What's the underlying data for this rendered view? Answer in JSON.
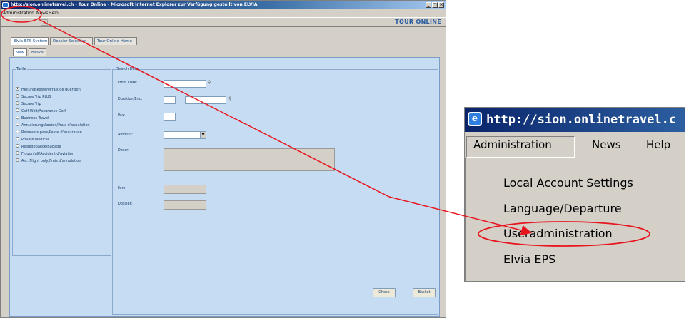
{
  "window": {
    "title": "http://sion.onlinetravel.ch - Tour Online - Microsoft Internet Explorer zur Verfügung gestellt von ELVIA",
    "controls": [
      "_",
      "□",
      "×"
    ]
  },
  "menubar": {
    "items": [
      "Administration",
      "News",
      "Help"
    ]
  },
  "toolbar": {
    "button_label": "»",
    "brand": "TOUR ONLINE"
  },
  "tabs": {
    "top": [
      "Elvia EPS System",
      "Dossier Selection",
      "Tour Online Home"
    ],
    "sub": [
      "New",
      "Basket"
    ]
  },
  "tarife": {
    "legend": "Tarife",
    "options": [
      "Heilungskosten/Frais de guerison",
      "Secure Trip PLUS",
      "Secure Trip",
      "Golf Welt/Assurance Golf",
      "Business Travel",
      "Annulierungskosten/Frais d'annulation",
      "Reisevers.pass/Passe d'assurance",
      "Private Medical",
      "Reisegepaeck/Bagage",
      "Flugunfall/Accident d'aviation",
      "An.. Flight only/Frais d'annulation"
    ]
  },
  "search": {
    "legend": "Search Data",
    "from_date": "From Date:",
    "duration_end": "Duration/End:",
    "pax": "Pax:",
    "amount": "Amount:",
    "descr": "Descr:",
    "fare": "Fare:",
    "dossier": "Dossier:"
  },
  "buttons": {
    "check": "Check",
    "basket": "Basket"
  },
  "zoom": {
    "title": "http://sion.onlinetravel.c",
    "menubar": [
      "Administration",
      "News",
      "Help"
    ],
    "dropdown": [
      "Local Account Settings",
      "Language/Departure",
      "Useradministration",
      "Elvia EPS"
    ]
  },
  "colors": {
    "highlight": "#e8141e",
    "panel": "#c5dcf2",
    "titlebar": "#0a246a",
    "brand": "#2a5d9f"
  }
}
